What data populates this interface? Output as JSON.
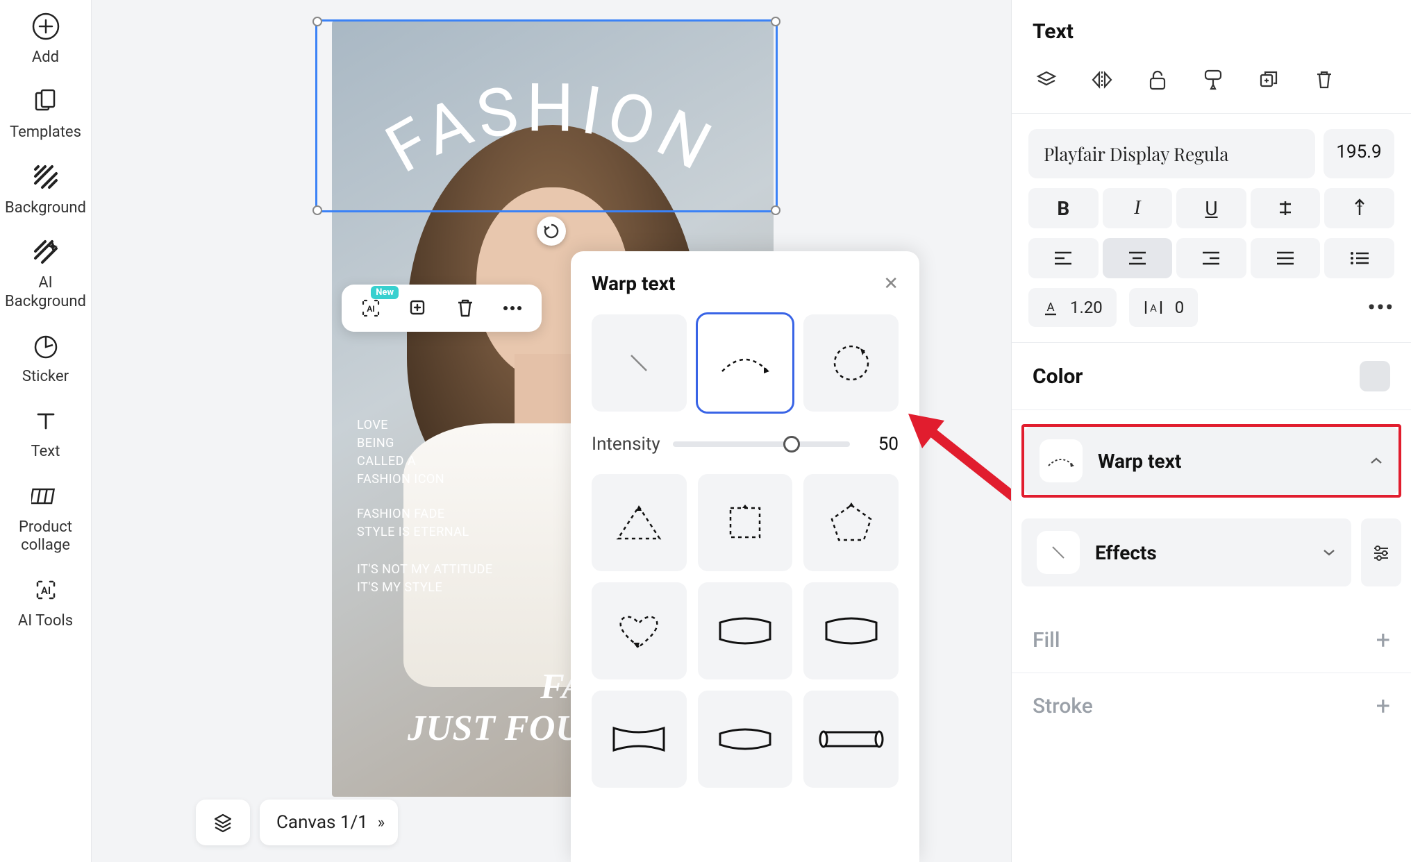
{
  "left_sidebar": [
    {
      "id": "add",
      "label": "Add"
    },
    {
      "id": "templates",
      "label": "Templates"
    },
    {
      "id": "background",
      "label": "Background"
    },
    {
      "id": "ai-background",
      "label": "AI\nBackground"
    },
    {
      "id": "sticker",
      "label": "Sticker"
    },
    {
      "id": "text",
      "label": "Text"
    },
    {
      "id": "product-collage",
      "label": "Product\ncollage"
    },
    {
      "id": "ai-tools",
      "label": "AI Tools"
    }
  ],
  "bottom": {
    "canvas_label": "Canvas 1/1"
  },
  "canvas": {
    "headline": "FASHION",
    "block1": "LOVE\nBEING\nCALLED A\nFASHION ICON",
    "block2": "FASHION FADE\nSTYLE IS ETERNAL",
    "block3": "IT'S NOT MY ATTITUDE\nIT'S MY STYLE",
    "big": "FASH\nJUST FOUND"
  },
  "ctx_toolbar": {
    "new_badge": "New"
  },
  "warp_panel": {
    "title": "Warp text",
    "intensity_label": "Intensity",
    "intensity_value": "50",
    "selected_index": 1
  },
  "right_panel": {
    "title": "Text",
    "font_name": "Playfair Display Regula",
    "font_size": "195.9",
    "line_height": "1.20",
    "letter_spacing": "0",
    "color_label": "Color",
    "warp_label": "Warp text",
    "effects_label": "Effects",
    "fill_label": "Fill",
    "stroke_label": "Stroke"
  }
}
